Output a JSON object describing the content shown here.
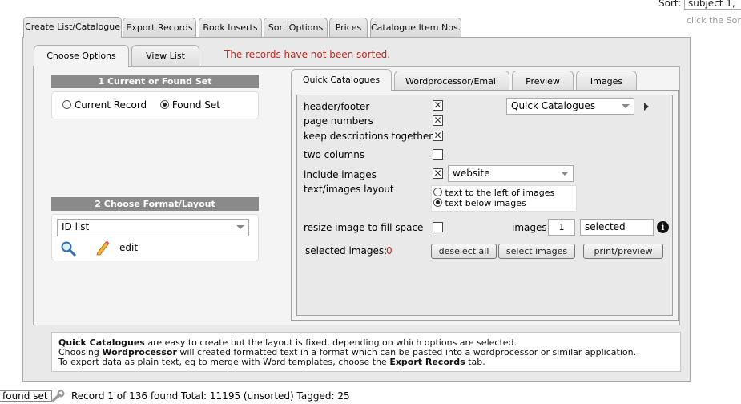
{
  "sort": {
    "label": "Sort:",
    "field_value": "subject 1,",
    "hint": "click the Sort"
  },
  "main_tabs": [
    {
      "label": "Create List/Catalogue"
    },
    {
      "label": "Export Records"
    },
    {
      "label": "Book Inserts"
    },
    {
      "label": "Sort Options"
    },
    {
      "label": "Prices"
    },
    {
      "label": "Catalogue Item Nos."
    }
  ],
  "sub_tabs": [
    {
      "label": "Choose Options"
    },
    {
      "label": "View List"
    }
  ],
  "warning": "The records have not been sorted.",
  "section1": {
    "title": "1 Current or Found Set",
    "option_current": "Current Record",
    "option_found": "Found Set"
  },
  "section2": {
    "title": "2 Choose Format/Layout",
    "format_value": "ID list",
    "edit_label": "edit"
  },
  "qc_tabs": [
    {
      "label": "Quick Catalogues"
    },
    {
      "label": "Wordprocessor/Email"
    },
    {
      "label": "Preview"
    },
    {
      "label": "Images"
    }
  ],
  "qc": {
    "header_footer": "header/footer",
    "template_value": "Quick Catalogues",
    "page_numbers": "page numbers",
    "keep_together": "keep descriptions together",
    "two_columns": "two columns",
    "include_images": "include images",
    "images_source": "website",
    "text_images_layout": "text/images layout",
    "layout_left": "text to the left of images",
    "layout_below": "text below images",
    "resize_image": "resize image to fill space",
    "images_label": "images",
    "images_count": "1",
    "images_selection": "selected",
    "selected_images_label": "selected images:",
    "selected_images_count": "0",
    "deselect_all": "deselect all",
    "select_images": "select images",
    "print_preview": "print/preview"
  },
  "info": {
    "line1_bold": "Quick Catalogues",
    "line1_rest": " are easy to create but the layout is fixed, depending on which options are selected.",
    "line2_pre": "Choosing ",
    "line2_bold": "Wordprocessor",
    "line2_rest": " will created formatted text in a format which can be pasted into a wordprocessor or similar application.",
    "line3_pre": "To export data as plain text, eg to merge with Word templates, choose the ",
    "line3_bold": "Export Records",
    "line3_rest": " tab."
  },
  "status": {
    "found_set": "found set",
    "record_text": "Record 1 of 136 found   Total: 11195 (unsorted)   Tagged: 25"
  }
}
